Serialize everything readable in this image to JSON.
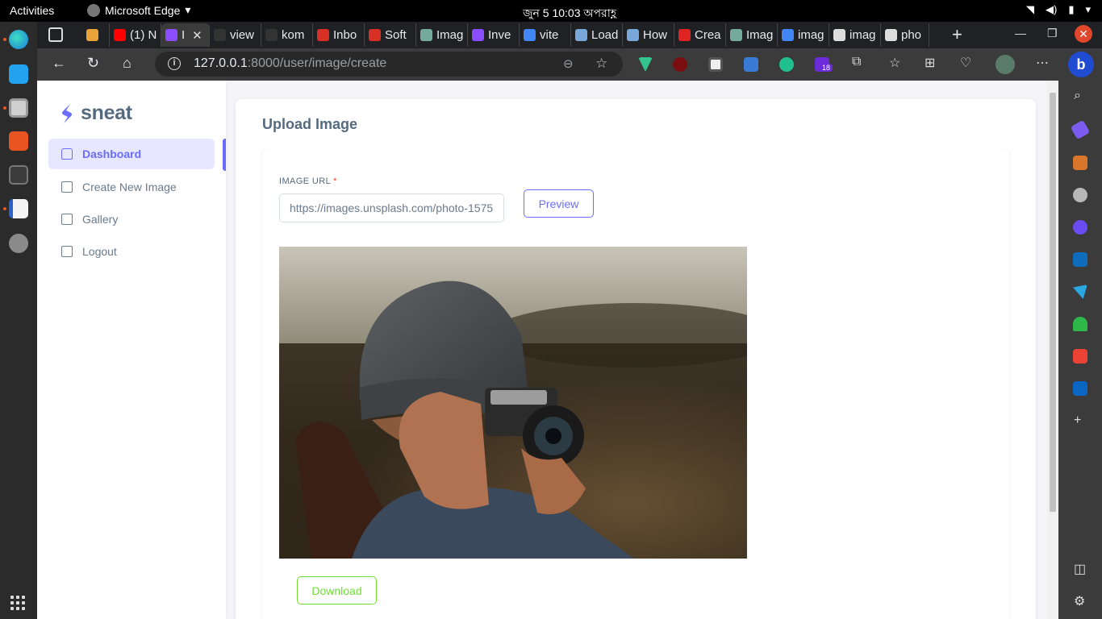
{
  "system": {
    "activities": "Activities",
    "app_name": "Microsoft Edge",
    "clock": "জুন 5  10:03 অপরাহ্ণ"
  },
  "browser": {
    "tabs": [
      {
        "label": "",
        "favicon_color": "#e8a33a"
      },
      {
        "label": "(1) N",
        "favicon_color": "#ff0000"
      },
      {
        "label": "I",
        "favicon_color": "#8a4dff",
        "active": true
      },
      {
        "label": "view",
        "favicon_color": "#333333"
      },
      {
        "label": "kom",
        "favicon_color": "#333333"
      },
      {
        "label": "Inbo",
        "favicon_color": "#d93025"
      },
      {
        "label": "Soft",
        "favicon_color": "#d93025"
      },
      {
        "label": "Imag",
        "favicon_color": "#74aa9c"
      },
      {
        "label": "Inve",
        "favicon_color": "#8a4dff"
      },
      {
        "label": "vite",
        "favicon_color": "#4285f4"
      },
      {
        "label": "Load",
        "favicon_color": "#7aa7d9"
      },
      {
        "label": "How",
        "favicon_color": "#7aa7d9"
      },
      {
        "label": "Crea",
        "favicon_color": "#e02424"
      },
      {
        "label": "Imag",
        "favicon_color": "#74aa9c"
      },
      {
        "label": "imag",
        "favicon_color": "#4285f4"
      },
      {
        "label": "imag",
        "favicon_color": "#dddddd"
      },
      {
        "label": "pho",
        "favicon_color": "#dddddd"
      }
    ],
    "url_host": "127.0.0.1",
    "url_path": ":8000/user/image/create",
    "extension_badge": "18"
  },
  "app": {
    "logo_text": "sneat",
    "menu": [
      {
        "label": "Dashboard",
        "icon": "home-icon",
        "active": true
      },
      {
        "label": "Create New Image",
        "icon": "crown-icon"
      },
      {
        "label": "Gallery",
        "icon": "crown-icon"
      },
      {
        "label": "Logout",
        "icon": "crown-icon"
      }
    ]
  },
  "page": {
    "title": "Upload Image",
    "url_label": "IMAGE URL",
    "required_mark": "*",
    "url_value": "https://images.unsplash.com/photo-1575",
    "preview_label": "Preview",
    "download_label": "Download"
  },
  "colors": {
    "primary": "#696cff",
    "success": "#71dd37",
    "danger": "#ff3e1d"
  }
}
